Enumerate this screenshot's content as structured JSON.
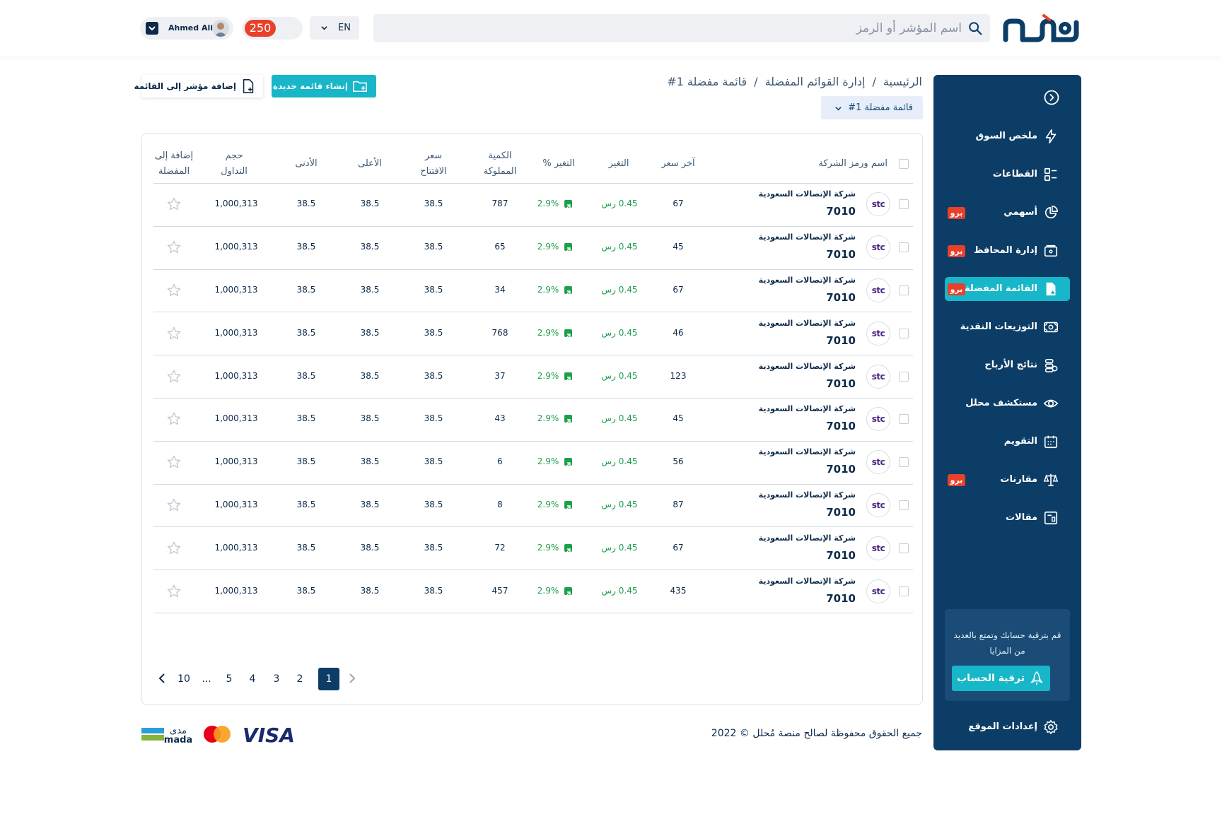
{
  "header": {
    "search_placeholder": "اسم المؤشر أو الرمز",
    "language": "EN",
    "points": "250",
    "user_name": "Ahmed Ali"
  },
  "sidebar": {
    "items": [
      {
        "label": "ملخص السوق",
        "icon": "lightning-icon",
        "pro": ""
      },
      {
        "label": "القطاعات",
        "icon": "sectors-icon",
        "pro": ""
      },
      {
        "label": "أسهمي",
        "icon": "pie-chart-icon",
        "pro": "برو"
      },
      {
        "label": "إدارة المحافظ",
        "icon": "wallet-icon",
        "pro": "برو"
      },
      {
        "label": "القائمة المفضلة",
        "icon": "favorite-list-icon",
        "pro": "برو"
      },
      {
        "label": "التوزيعات النقدية",
        "icon": "money-icon",
        "pro": ""
      },
      {
        "label": "نتائج الأرباح",
        "icon": "coins-icon",
        "pro": ""
      },
      {
        "label": "مستكشف محلل",
        "icon": "eye-icon",
        "pro": ""
      },
      {
        "label": "التقويم",
        "icon": "calendar-icon",
        "pro": ""
      },
      {
        "label": "مقارنات",
        "icon": "scale-icon",
        "pro": "برو"
      },
      {
        "label": "مقالات",
        "icon": "article-icon",
        "pro": ""
      }
    ],
    "upgrade_text": "قم بترقية حسابك وتمتع بالعديد من المزايا",
    "upgrade_button": "ترقية الحساب",
    "settings": "إعدادات الموقع"
  },
  "breadcrumb": [
    "الرئيسية",
    "إدارة القوائم المفضلة",
    "قائمة مفضلة 1#"
  ],
  "list_select": "قائمة مفضلة 1#",
  "buttons": {
    "create_list": "إنشاء قائمة جديدة",
    "add_index": "إضافة مؤشر إلى القائمة"
  },
  "table": {
    "headers": {
      "name": "اسم ورمز الشركة",
      "last_price": "آخر سعر",
      "change": "التغير",
      "change_pct": "التغير %",
      "quantity": "الكمية المملوكة",
      "open": "سعر الافتتاح",
      "high": "الأعلى",
      "low": "الأدنى",
      "volume": "حجم التداول",
      "favorite": "إضافة إلى المفضلة"
    },
    "rows": [
      {
        "company": "شركة الإتصالات السعودية",
        "code": "7010",
        "logo": "stc",
        "last": "67",
        "change": "0.45 رس",
        "pct": "2.9%",
        "qty": "787",
        "open": "38.5",
        "high": "38.5",
        "low": "38.5",
        "volume": "1,000,313"
      },
      {
        "company": "شركة الإتصالات السعودية",
        "code": "7010",
        "logo": "stc",
        "last": "45",
        "change": "0.45 رس",
        "pct": "2.9%",
        "qty": "65",
        "open": "38.5",
        "high": "38.5",
        "low": "38.5",
        "volume": "1,000,313"
      },
      {
        "company": "شركة الإتصالات السعودية",
        "code": "7010",
        "logo": "stc",
        "last": "67",
        "change": "0.45 رس",
        "pct": "2.9%",
        "qty": "34",
        "open": "38.5",
        "high": "38.5",
        "low": "38.5",
        "volume": "1,000,313"
      },
      {
        "company": "شركة الإتصالات السعودية",
        "code": "7010",
        "logo": "stc",
        "last": "46",
        "change": "0.45 رس",
        "pct": "2.9%",
        "qty": "768",
        "open": "38.5",
        "high": "38.5",
        "low": "38.5",
        "volume": "1,000,313"
      },
      {
        "company": "شركة الإتصالات السعودية",
        "code": "7010",
        "logo": "stc",
        "last": "123",
        "change": "0.45 رس",
        "pct": "2.9%",
        "qty": "37",
        "open": "38.5",
        "high": "38.5",
        "low": "38.5",
        "volume": "1,000,313"
      },
      {
        "company": "شركة الإتصالات السعودية",
        "code": "7010",
        "logo": "stc",
        "last": "45",
        "change": "0.45 رس",
        "pct": "2.9%",
        "qty": "43",
        "open": "38.5",
        "high": "38.5",
        "low": "38.5",
        "volume": "1,000,313"
      },
      {
        "company": "شركة الإتصالات السعودية",
        "code": "7010",
        "logo": "stc",
        "last": "56",
        "change": "0.45 رس",
        "pct": "2.9%",
        "qty": "6",
        "open": "38.5",
        "high": "38.5",
        "low": "38.5",
        "volume": "1,000,313"
      },
      {
        "company": "شركة الإتصالات السعودية",
        "code": "7010",
        "logo": "stc",
        "last": "87",
        "change": "0.45 رس",
        "pct": "2.9%",
        "qty": "8",
        "open": "38.5",
        "high": "38.5",
        "low": "38.5",
        "volume": "1,000,313"
      },
      {
        "company": "شركة الإتصالات السعودية",
        "code": "7010",
        "logo": "stc",
        "last": "67",
        "change": "0.45 رس",
        "pct": "2.9%",
        "qty": "72",
        "open": "38.5",
        "high": "38.5",
        "low": "38.5",
        "volume": "1,000,313"
      },
      {
        "company": "شركة الإتصالات السعودية",
        "code": "7010",
        "logo": "stc",
        "last": "435",
        "change": "0.45 رس",
        "pct": "2.9%",
        "qty": "457",
        "open": "38.5",
        "high": "38.5",
        "low": "38.5",
        "volume": "1,000,313"
      }
    ]
  },
  "pagination": {
    "pages": [
      "1",
      "2",
      "3",
      "4",
      "5",
      "...",
      "10"
    ],
    "current": "1"
  },
  "footer": {
    "copyright": "جميع الحقوق محفوظة لصالح منصة مُحلل © 2022",
    "payment_methods": [
      "VISA",
      "mastercard",
      "mada"
    ],
    "mada_arabic": "مدى",
    "mada_latin": "mada"
  },
  "colors": {
    "primary": "#0c3d66",
    "accent": "#17b6c8",
    "positive": "#1e9f4b",
    "pro_badge": "#e8402a"
  }
}
